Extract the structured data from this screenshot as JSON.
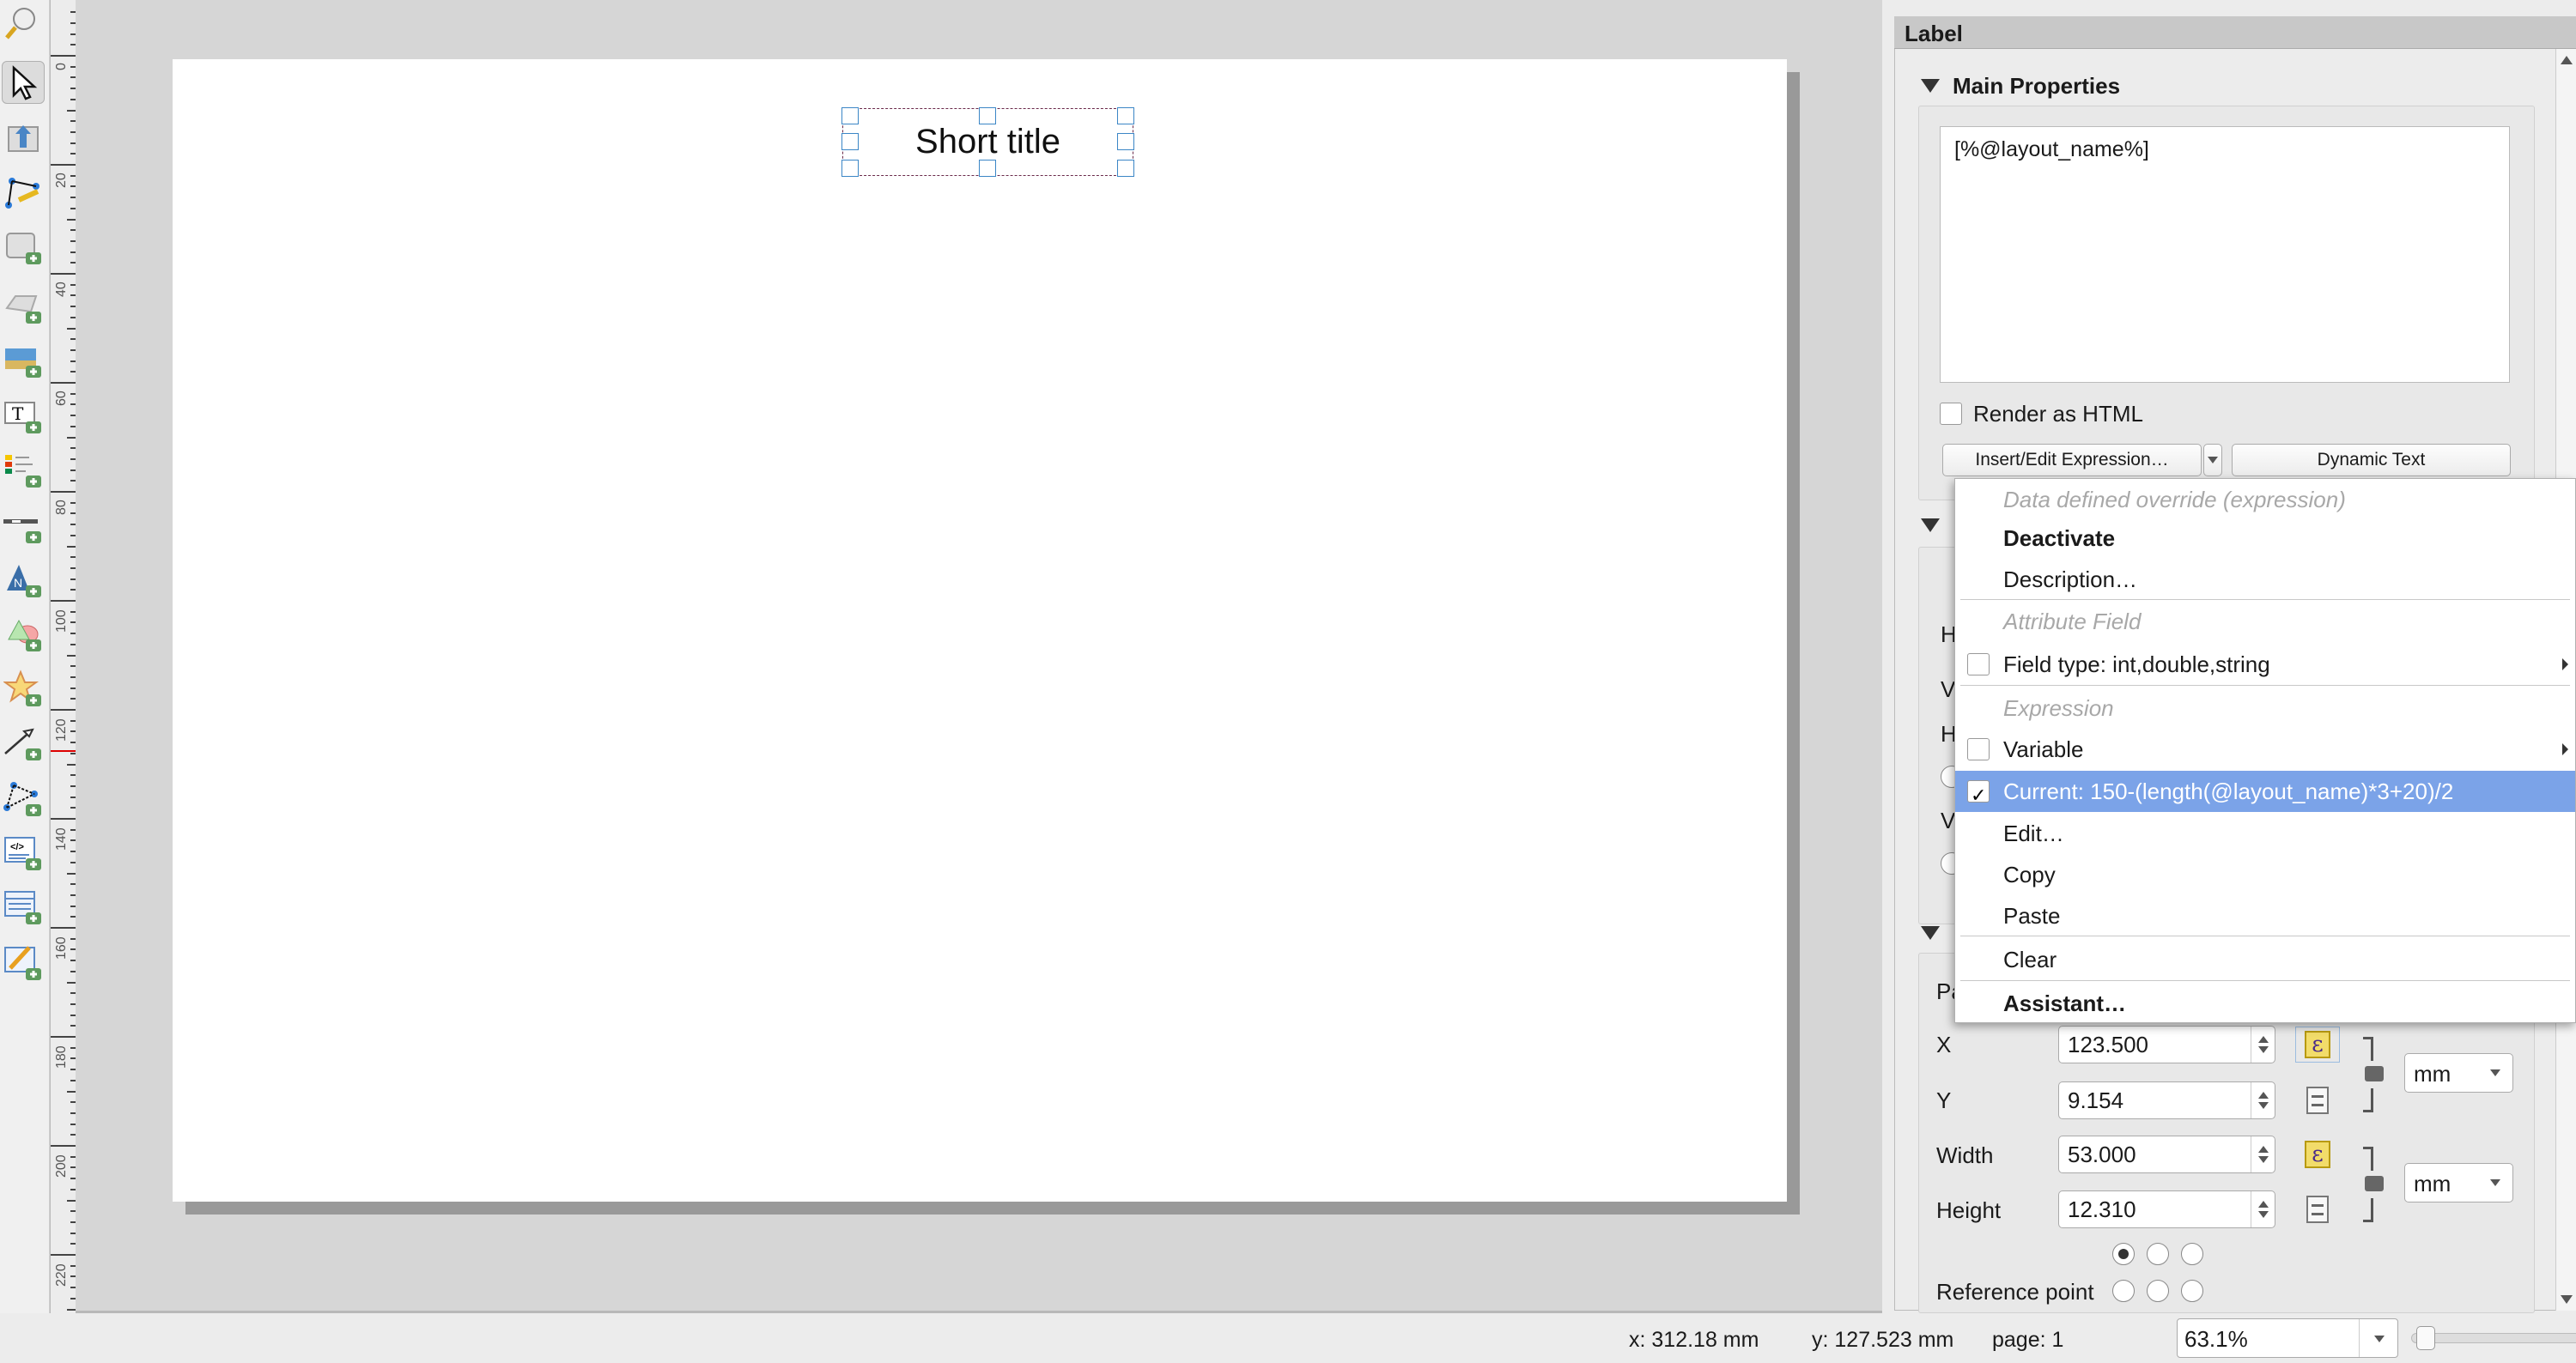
{
  "toolbar": {
    "tools": [
      {
        "name": "zoom-tool-icon",
        "active": false
      },
      {
        "name": "select-move-item-icon",
        "active": true
      },
      {
        "name": "move-content-icon",
        "active": false
      },
      {
        "name": "edit-nodes-icon",
        "active": false
      },
      {
        "name": "add-map-icon",
        "active": false
      },
      {
        "name": "add-3d-map-icon",
        "active": false
      },
      {
        "name": "add-picture-icon",
        "active": false
      },
      {
        "name": "add-label-icon",
        "active": false
      },
      {
        "name": "add-legend-icon",
        "active": false
      },
      {
        "name": "add-scalebar-icon",
        "active": false
      },
      {
        "name": "add-north-arrow-icon",
        "active": false
      },
      {
        "name": "add-shape-icon",
        "active": false
      },
      {
        "name": "add-marker-icon",
        "active": false
      },
      {
        "name": "add-arrow-icon",
        "active": false
      },
      {
        "name": "add-node-item-icon",
        "active": false
      },
      {
        "name": "add-html-icon",
        "active": false
      },
      {
        "name": "add-attribute-table-icon",
        "active": false
      },
      {
        "name": "add-fixed-table-icon",
        "active": false
      }
    ]
  },
  "ruler": {
    "labels": [
      "0",
      "20",
      "40",
      "60",
      "80",
      "100",
      "120",
      "140",
      "160",
      "180",
      "200",
      "220"
    ],
    "cursor_mm": 127.523
  },
  "canvas": {
    "label_text": "Short title"
  },
  "panel": {
    "title": "Label",
    "main_properties": "Main Properties",
    "text_value": "[%@layout_name%]",
    "render_html": "Render as HTML",
    "insert_expression": "Insert/Edit Expression…",
    "dynamic_text": "Dynamic Text",
    "hidden_labels": [
      "H",
      "V",
      "H",
      "V"
    ],
    "position_partial": "Pa",
    "x_label": "X",
    "x_value": "123.500",
    "y_label": "Y",
    "y_value": "9.154",
    "width_label": "Width",
    "width_value": "53.000",
    "height_label": "Height",
    "height_value": "12.310",
    "unit_position": "mm",
    "unit_size": "mm",
    "reference_point": "Reference point"
  },
  "menu": {
    "items": [
      {
        "label": "Data defined override (expression)",
        "kind": "header"
      },
      {
        "label": "Deactivate",
        "kind": "bold"
      },
      {
        "label": "Description…",
        "kind": "item"
      },
      {
        "label": "Attribute Field",
        "kind": "header"
      },
      {
        "label": "Field type: int,double,string",
        "kind": "check",
        "checked": false,
        "submenu": true
      },
      {
        "label": "Expression",
        "kind": "header"
      },
      {
        "label": "Variable",
        "kind": "check",
        "checked": false,
        "submenu": true
      },
      {
        "label": "Current: 150-(length(@layout_name)*3+20)/2",
        "kind": "check",
        "checked": true,
        "selected": true
      },
      {
        "label": "Edit…",
        "kind": "item"
      },
      {
        "label": "Copy",
        "kind": "item"
      },
      {
        "label": "Paste",
        "kind": "item"
      },
      {
        "label": "Clear",
        "kind": "item"
      },
      {
        "label": "Assistant…",
        "kind": "bold"
      }
    ]
  },
  "status": {
    "x": "x: 312.18 mm",
    "y": "y: 127.523 mm",
    "page": "page: 1",
    "zoom": "63.1%"
  },
  "colors": {
    "selection": "#7ba3e8",
    "handle": "#3b86c6",
    "data_defined_active": "#f2dc6a"
  }
}
